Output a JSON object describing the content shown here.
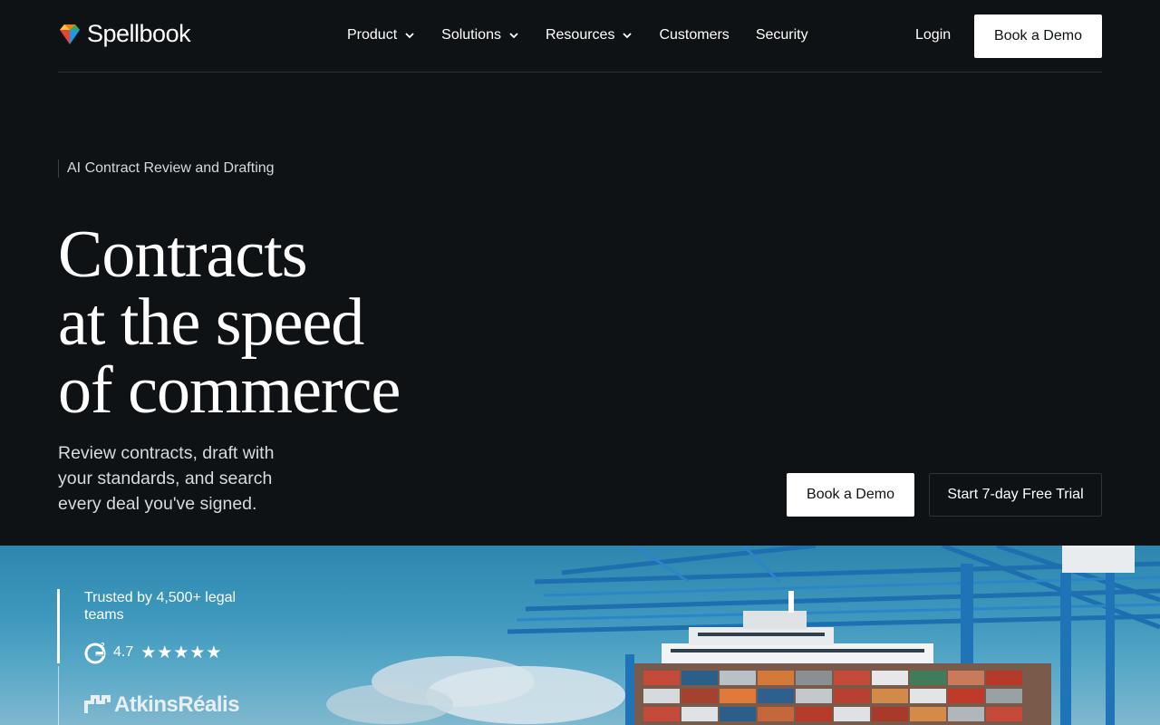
{
  "brand": {
    "name": "Spellbook"
  },
  "nav": {
    "items": [
      {
        "label": "Product",
        "dropdown": true
      },
      {
        "label": "Solutions",
        "dropdown": true
      },
      {
        "label": "Resources",
        "dropdown": true
      },
      {
        "label": "Customers",
        "dropdown": false
      },
      {
        "label": "Security",
        "dropdown": false
      }
    ],
    "login": "Login",
    "cta": "Book a Demo"
  },
  "hero": {
    "eyebrow": "AI Contract Review and Drafting",
    "headline": [
      "Contracts",
      "at the speed",
      "of commerce"
    ],
    "subcopy": "Review contracts, draft with your standards, and search every deal you've signed.",
    "primary_cta": "Book a Demo",
    "secondary_cta": "Start 7-day Free Trial"
  },
  "trust": {
    "text": "Trusted by 4,500+ legal teams",
    "rating": "4.7",
    "stars": "★★★★★",
    "rating_icon": "g2-icon",
    "client_logo": "AtkinsRéalis"
  },
  "colors": {
    "background": "#0e1215",
    "primary_button_bg": "#ffffff",
    "primary_button_text": "#0e1215",
    "text": "#ffffff"
  }
}
